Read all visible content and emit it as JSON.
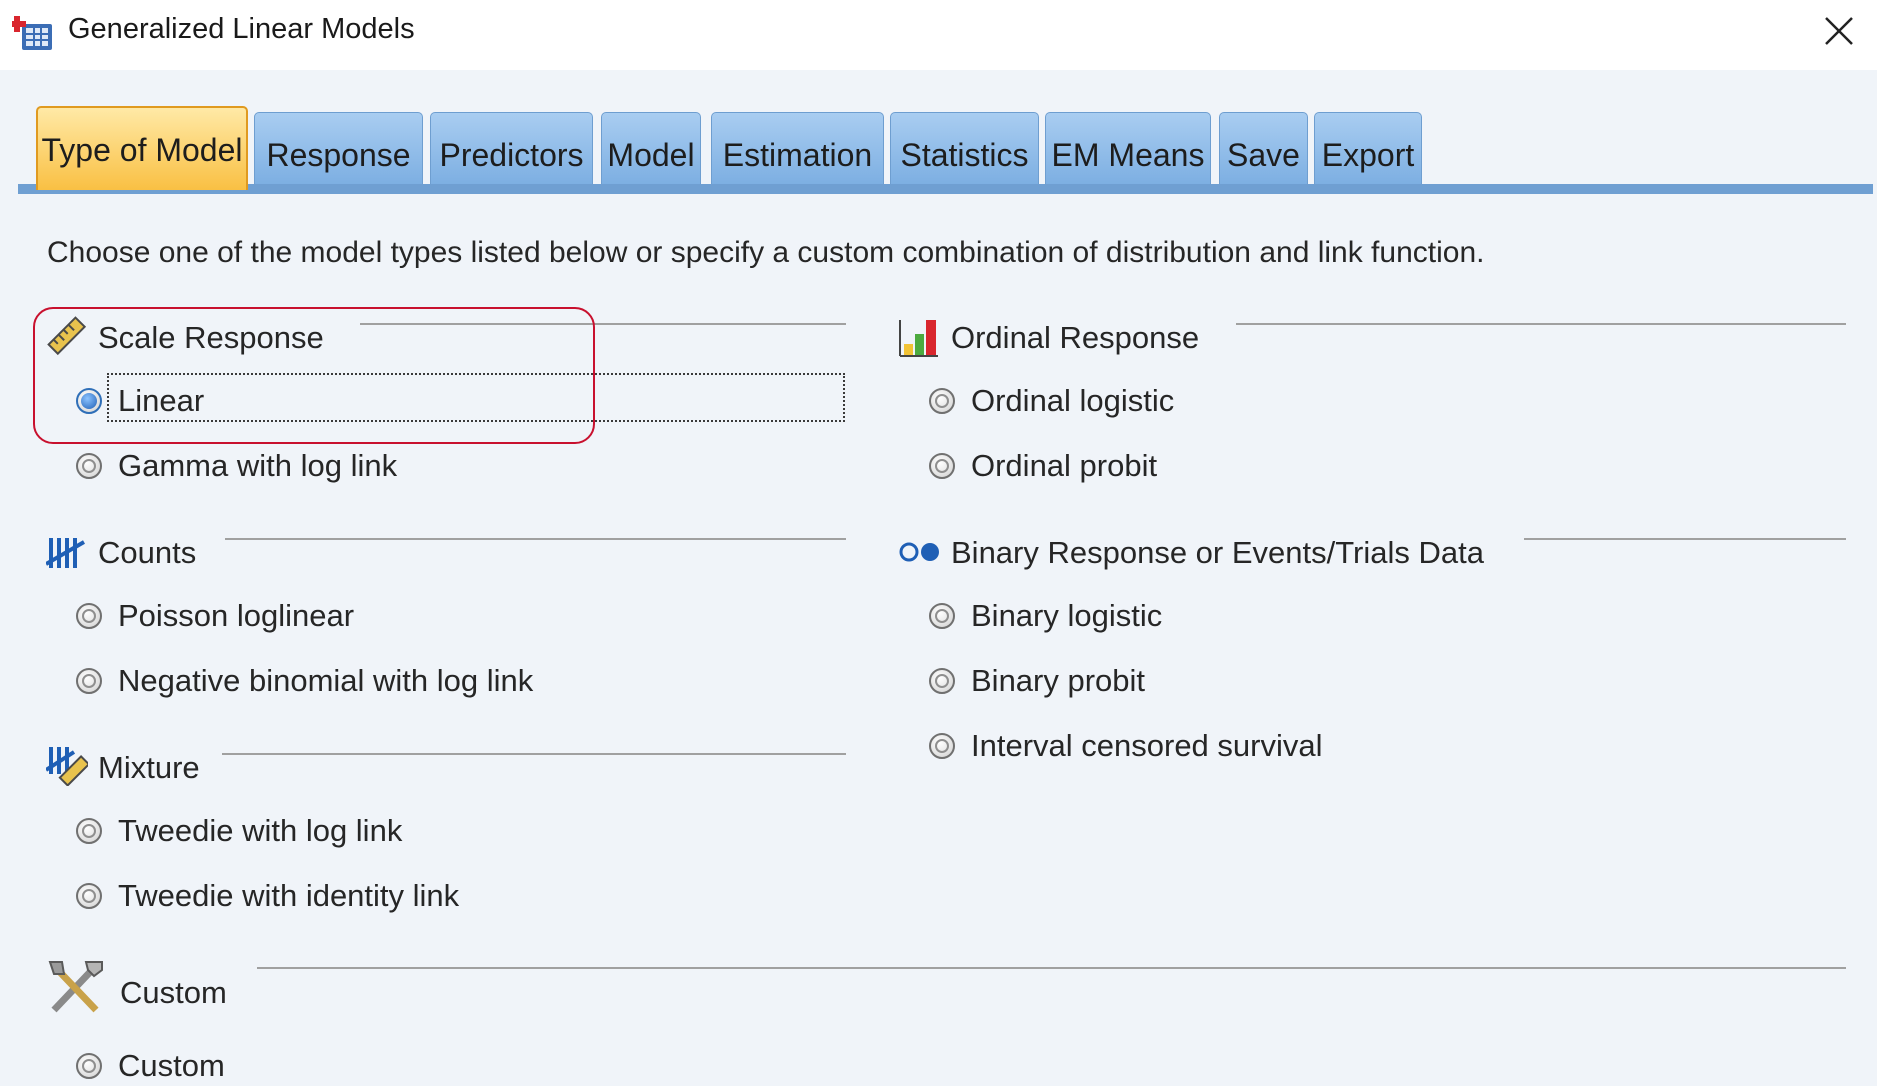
{
  "window": {
    "title": "Generalized Linear Models"
  },
  "tabs": [
    {
      "label": "Type of Model",
      "active": true
    },
    {
      "label": "Response"
    },
    {
      "label": "Predictors"
    },
    {
      "label": "Model"
    },
    {
      "label": "Estimation"
    },
    {
      "label": "Statistics"
    },
    {
      "label": "EM Means"
    },
    {
      "label": "Save"
    },
    {
      "label": "Export"
    }
  ],
  "instructions": "Choose one of the model types listed below or specify a custom combination of distribution and link function.",
  "groups": {
    "scale": {
      "title": "Scale Response",
      "icon": "ruler-icon",
      "options": [
        {
          "label": "Linear",
          "checked": true
        },
        {
          "label": "Gamma with log link"
        }
      ]
    },
    "ordinal": {
      "title": "Ordinal Response",
      "icon": "bar-chart-icon",
      "options": [
        {
          "label": "Ordinal logistic"
        },
        {
          "label": "Ordinal probit"
        }
      ]
    },
    "counts": {
      "title": "Counts",
      "icon": "tally-icon",
      "options": [
        {
          "label": "Poisson loglinear"
        },
        {
          "label": "Negative binomial with log link"
        }
      ]
    },
    "binary": {
      "title": "Binary Response or Events/Trials Data",
      "icon": "binary-dots-icon",
      "options": [
        {
          "label": "Binary logistic"
        },
        {
          "label": "Binary probit"
        },
        {
          "label": "Interval censored survival"
        }
      ]
    },
    "mixture": {
      "title": "Mixture",
      "icon": "mixture-icon",
      "options": [
        {
          "label": "Tweedie with log link"
        },
        {
          "label": "Tweedie with identity link"
        }
      ]
    },
    "custom": {
      "title": "Custom",
      "icon": "tools-icon",
      "options": [
        {
          "label": "Custom"
        }
      ]
    }
  },
  "colors": {
    "tab_active": "#f9c043",
    "tab_inactive": "#7dafe2",
    "highlight": "#c8102e"
  }
}
